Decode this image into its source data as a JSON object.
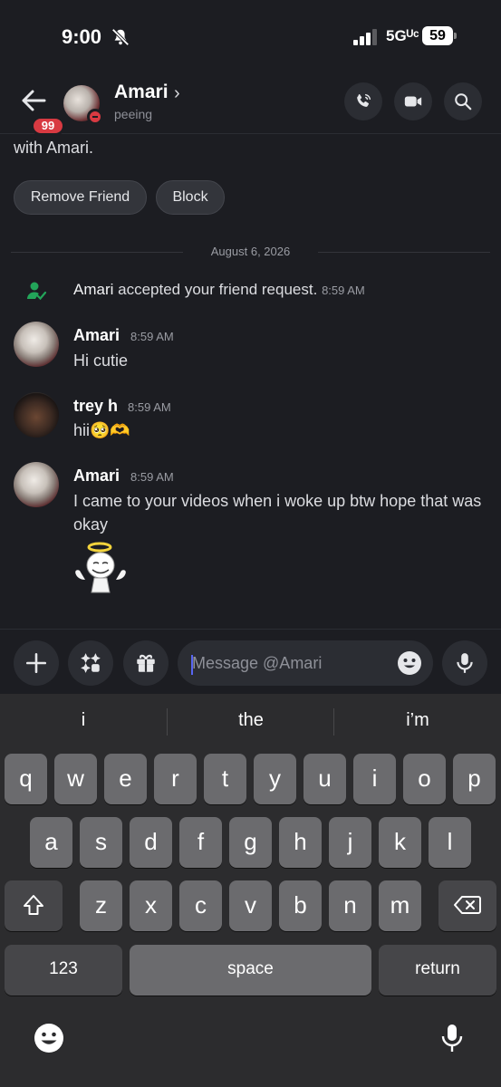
{
  "status_bar": {
    "time": "9:00",
    "network": "5Gᵁᶜ",
    "battery": "59"
  },
  "header": {
    "badge": "99",
    "name": "Amari",
    "chevron": "›",
    "status": "peeing"
  },
  "intro": {
    "text": "with Amari.",
    "remove_friend": "Remove Friend",
    "block": "Block"
  },
  "date_divider": "August 6, 2026",
  "system_message": {
    "name": "Amari",
    "text": " accepted your friend request.",
    "time": "8:59 AM"
  },
  "messages": [
    {
      "name": "Amari",
      "time": "8:59 AM",
      "text": "Hi cutie"
    },
    {
      "name": "trey h",
      "time": "8:59 AM",
      "text": "hii🥺🫶"
    },
    {
      "name": "Amari",
      "time": "8:59 AM",
      "text": "I came to your videos when i woke up btw hope that was okay"
    }
  ],
  "composer": {
    "placeholder": "Message @Amari"
  },
  "keyboard": {
    "suggestions": [
      "i",
      "the",
      "i’m"
    ],
    "row1": [
      "q",
      "w",
      "e",
      "r",
      "t",
      "y",
      "u",
      "i",
      "o",
      "p"
    ],
    "row2": [
      "a",
      "s",
      "d",
      "f",
      "g",
      "h",
      "j",
      "k",
      "l"
    ],
    "row3": [
      "z",
      "x",
      "c",
      "v",
      "b",
      "n",
      "m"
    ],
    "numbers": "123",
    "space": "space",
    "return": "return"
  },
  "colors": {
    "accent": "#5865f2",
    "dnd_red": "#d83a42",
    "online_green": "#23a55a"
  }
}
